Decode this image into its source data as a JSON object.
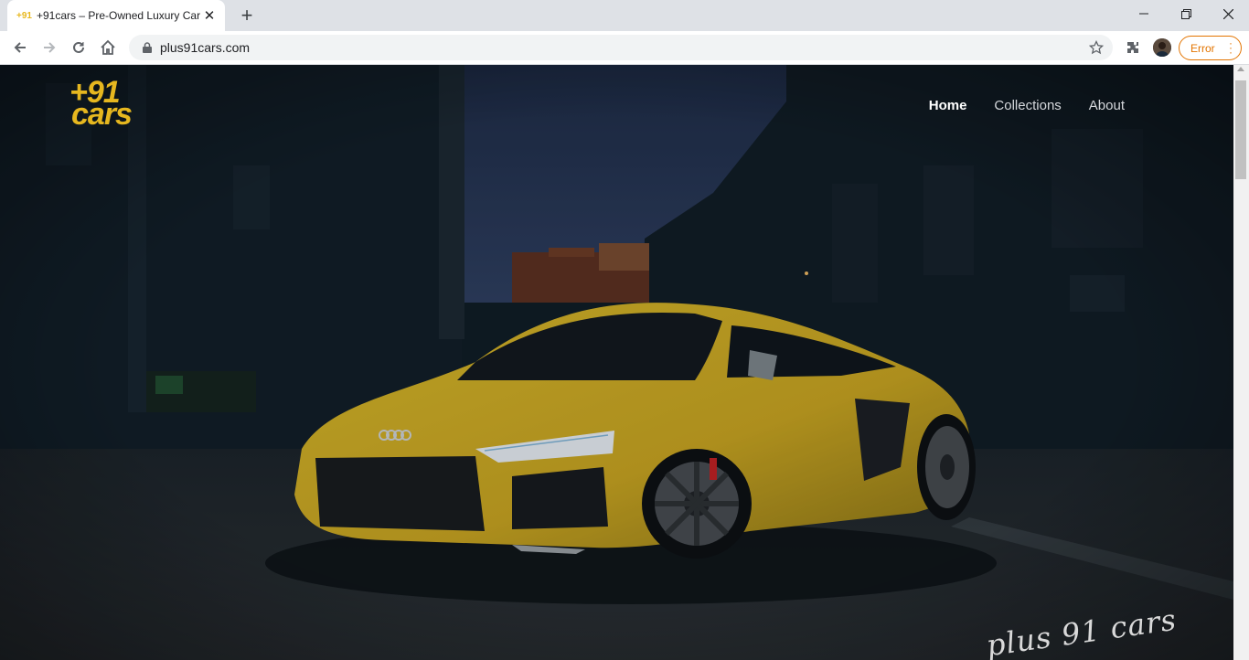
{
  "browser": {
    "tab": {
      "favicon_text": "+91",
      "title": "+91cars – Pre-Owned Luxury Car"
    },
    "omnibox": {
      "url": "plus91cars.com"
    },
    "error_button_label": "Error"
  },
  "site": {
    "logo": {
      "line1": "+91",
      "line2": "cars"
    },
    "nav": [
      {
        "label": "Home",
        "active": true
      },
      {
        "label": "Collections",
        "active": false
      },
      {
        "label": "About",
        "active": false
      }
    ],
    "signature_text": "plus 91 cars"
  },
  "colors": {
    "brand_yellow": "#e6b71f",
    "error_orange": "#e37400",
    "hero_bg": "#0e1820"
  }
}
